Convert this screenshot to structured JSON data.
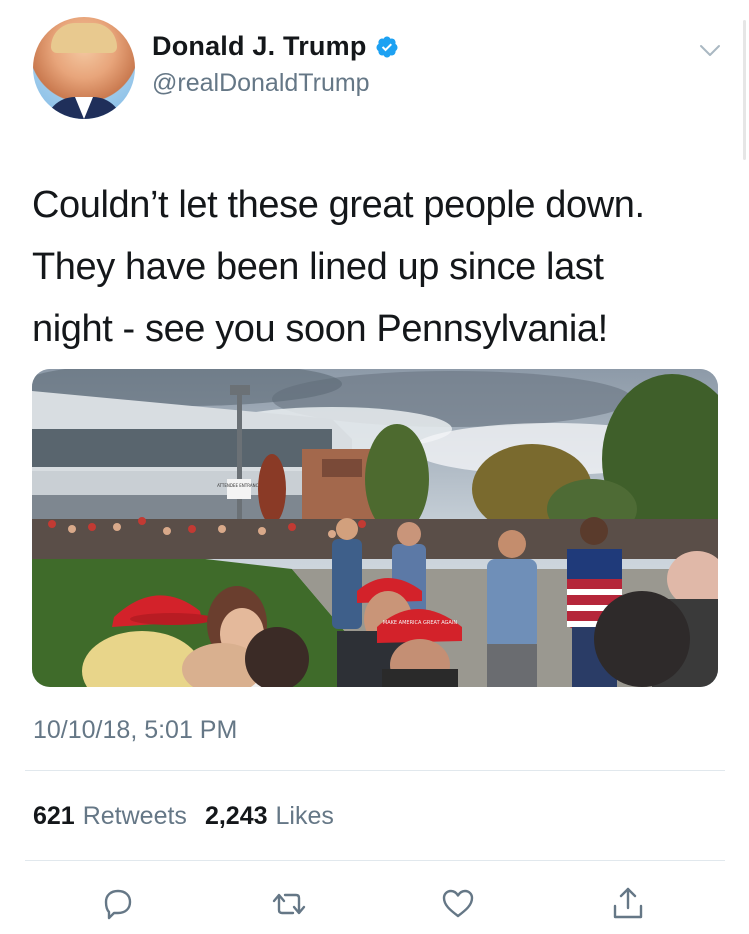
{
  "author": {
    "name": "Donald J. Trump",
    "handle": "@realDonaldTrump",
    "verified": true
  },
  "tweet": {
    "text_lines": [
      "Couldn’t let these great people down.",
      "They have been lined up since last",
      "night - see you soon Pennsylvania!"
    ],
    "timestamp": "10/10/18, 5:01 PM"
  },
  "stats": {
    "retweets_count": "621",
    "retweets_label": "Retweets",
    "likes_count": "2,243",
    "likes_label": "Likes"
  },
  "media": {
    "sign_text": "ATTENDEE ENTRANCE",
    "hat_text": "MAKE AMERICA GREAT AGAIN"
  },
  "icons": {
    "verified": "verified-badge-icon",
    "more": "chevron-down-icon",
    "reply": "reply-icon",
    "retweet": "retweet-icon",
    "like": "heart-icon",
    "share": "share-icon"
  },
  "colors": {
    "text": "#14171a",
    "secondary": "#657786",
    "verified": "#1da1f2",
    "divider": "#e1e8ed",
    "hat_red": "#d3222a"
  }
}
